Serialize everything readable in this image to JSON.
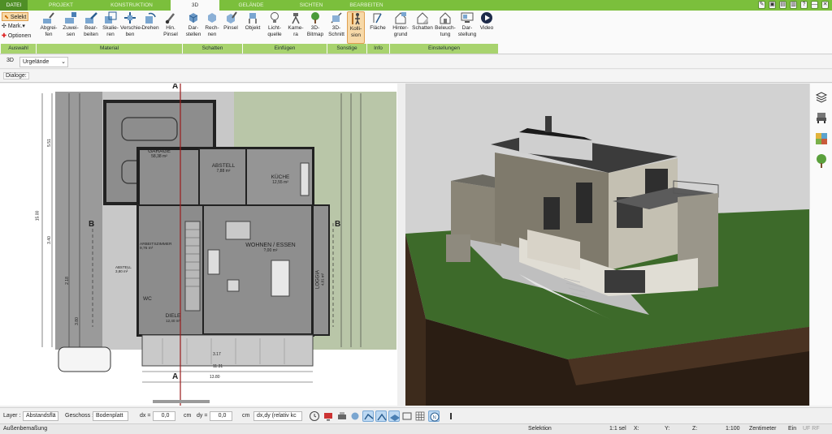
{
  "tabs": [
    {
      "label": "DATEI",
      "kind": "file"
    },
    {
      "label": "PROJEKT",
      "kind": "normal"
    },
    {
      "label": "KONSTRUKTION",
      "kind": "normal"
    },
    {
      "label": "3D",
      "kind": "active"
    },
    {
      "label": "GELÄNDE",
      "kind": "normal"
    },
    {
      "label": "SICHTEN",
      "kind": "normal"
    },
    {
      "label": "BEARBEITEN",
      "kind": "normal"
    }
  ],
  "window_controls": [
    "✎",
    "▣",
    "▤",
    "▥",
    "?",
    "—",
    "✕"
  ],
  "ribbon": {
    "auswahl": {
      "selekt": "Selekt",
      "mark": "Mark.",
      "optionen": "Optionen"
    },
    "material": [
      "Abgrei-\nfen",
      "Zuwei-\nsen",
      "Bear-\nbeiten",
      "Skalie-\nren",
      "Verschie-\nben",
      "Drehen",
      "Hin.\nPinsel"
    ],
    "schatten": [
      "Dar-\nstellen",
      "Rech-\nnen",
      "Pinsel"
    ],
    "einfuegen": [
      "Objekt",
      "Licht-\nquelle",
      "Kame-\nra",
      "3D-\nBitmap"
    ],
    "sonstige": [
      "3D-\nSchnitt",
      "Kolli-\nsion"
    ],
    "info": [
      "Fläche"
    ],
    "einstellungen": [
      "Hinter-\ngrund",
      "Schatten",
      "Beleuch-\ntung",
      "Dar-\nstellung",
      "Video"
    ],
    "groups": [
      "Auswahl",
      "Material",
      "Schatten",
      "Einfügen",
      "Sonstige",
      "Info",
      "Einstellungen"
    ]
  },
  "viewbar": {
    "mode": "3D",
    "terrain": "Urgelände"
  },
  "dialogbar": {
    "label": "Dialoge:"
  },
  "plan": {
    "rooms": [
      {
        "name": "GARAGE",
        "area": "58,38 m²"
      },
      {
        "name": "ABSTELL",
        "area": "7,88 m²"
      },
      {
        "name": "KÜCHE",
        "area": "12,55 m²"
      },
      {
        "name": "ARBEITSZIMMER",
        "area": "9,76 m²"
      },
      {
        "name": "WOHNEN / ESSEN",
        "area": "?,00 m²"
      },
      {
        "name": "LOGGIA",
        "area": "4,81 m²"
      },
      {
        "name": "WC",
        "area": ""
      },
      {
        "name": "DIELE",
        "area": "12,40 m²"
      },
      {
        "name": "ABSTELL",
        "area": "3,80 m²"
      }
    ],
    "markers": [
      "A",
      "A",
      "B",
      "B"
    ],
    "dims_vertical_left": [
      "15.00",
      "5.51",
      "3.40",
      "2.18",
      "3.80"
    ],
    "dims_bottom": [
      "13.80",
      "11.31",
      "3.17"
    ]
  },
  "inputbar": {
    "layer_label": "Layer :",
    "layer_value": "Abstandsflä",
    "geschoss_label": "Geschoss :",
    "geschoss_value": "Bodenplatt",
    "dx_label": "dx =",
    "dx_value": "0,0",
    "dx_unit": "cm",
    "dy_label": "dy =",
    "dy_value": "0,0",
    "dy_unit": "cm",
    "mode_value": "dx,dy (relativ kc"
  },
  "statusbar": {
    "left": "Außenbemaßung",
    "selektion": "Selektion",
    "scale": "1:1 sel",
    "x": "X:",
    "y": "Y:",
    "z": "Z:",
    "zoom": "1:100",
    "unit": "Zentimeter",
    "ein": "Ein",
    "flags": "UF RF"
  },
  "colors": {
    "tabbar": "#7bbf3c",
    "group_bar": "#a8d36e",
    "active_btn": "#f7d9a8",
    "grass": "#3f6b2c",
    "soil": "#4a3423"
  }
}
